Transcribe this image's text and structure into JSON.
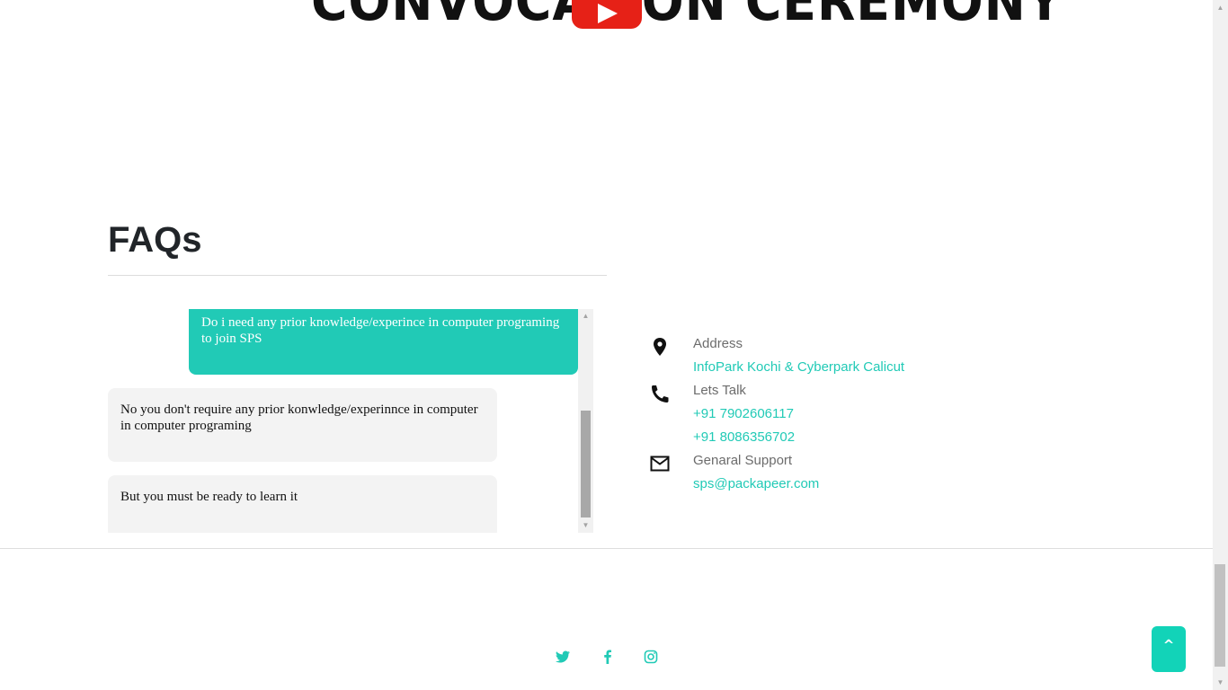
{
  "hero": {
    "video_title": "CONVOCATION CEREMONY",
    "play_icon": "youtube-play-icon"
  },
  "faq": {
    "title": "FAQs",
    "messages": [
      {
        "role": "question",
        "text": "Do i need any prior knowledge/experince in computer programing to join SPS"
      },
      {
        "role": "answer",
        "text": "No you don't require any prior konwledge/experinnce in computer in computer programing"
      },
      {
        "role": "answer",
        "text": "But you must be ready to learn it"
      }
    ]
  },
  "contact": {
    "address": {
      "icon": "location-pin-icon",
      "label": "Address",
      "value": "InfoPark Kochi & Cyberpark Calicut"
    },
    "talk": {
      "icon": "phone-icon",
      "label": "Lets Talk",
      "phones": [
        "+91 7902606117",
        "+91 8086356702"
      ]
    },
    "support": {
      "icon": "mail-icon",
      "label": "Genaral Support",
      "email": "sps@packapeer.com"
    }
  },
  "footer": {
    "social": [
      {
        "name": "twitter-icon"
      },
      {
        "name": "facebook-icon"
      },
      {
        "name": "instagram-icon"
      }
    ],
    "back_to_top_label": "^"
  },
  "colors": {
    "accent": "#21cab6",
    "question_bubble": "#21cab6",
    "answer_bubble": "#f3f3f3",
    "back_to_top": "#12d3b8",
    "youtube_red": "#e62117"
  }
}
